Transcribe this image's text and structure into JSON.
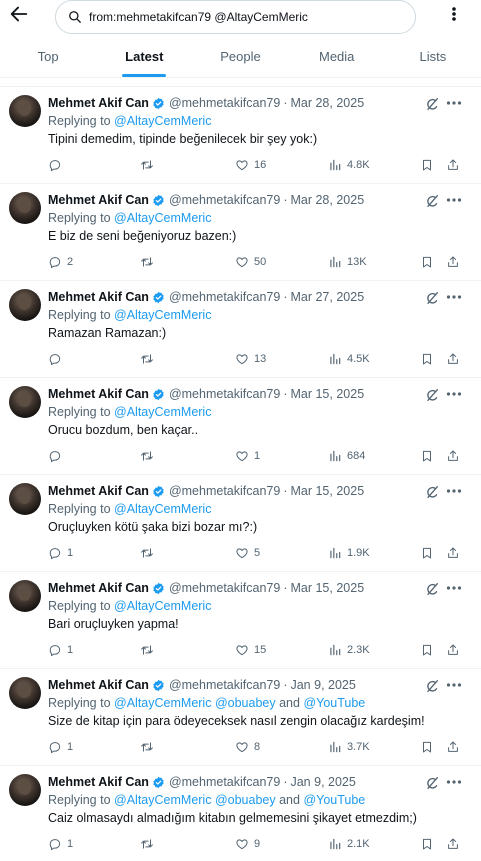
{
  "search": {
    "query": "from:mehmetakifcan79 @AltayCemMeric"
  },
  "tabs": [
    {
      "label": "Top",
      "active": false
    },
    {
      "label": "Latest",
      "active": true
    },
    {
      "label": "People",
      "active": false
    },
    {
      "label": "Media",
      "active": false
    },
    {
      "label": "Lists",
      "active": false
    }
  ],
  "colors": {
    "accent": "#1d9bf0",
    "muted": "#536471",
    "text": "#0f1419"
  },
  "tweets": [
    {
      "name": "Mehmet Akif Can",
      "handle": "@mehmetakifcan79",
      "date": "Mar 28, 2025",
      "replying_prefix": "Replying to",
      "mentions": [
        "@AltayCemMeric"
      ],
      "text": "Tipini demedim, tipinde beğenilecek bir şey yok:)",
      "replies": "",
      "retweets": "",
      "likes": "16",
      "views": "4.8K"
    },
    {
      "name": "Mehmet Akif Can",
      "handle": "@mehmetakifcan79",
      "date": "Mar 28, 2025",
      "replying_prefix": "Replying to",
      "mentions": [
        "@AltayCemMeric"
      ],
      "text": "E biz de seni beğeniyoruz bazen:)",
      "replies": "2",
      "retweets": "",
      "likes": "50",
      "views": "13K"
    },
    {
      "name": "Mehmet Akif Can",
      "handle": "@mehmetakifcan79",
      "date": "Mar 27, 2025",
      "replying_prefix": "Replying to",
      "mentions": [
        "@AltayCemMeric"
      ],
      "text": "Ramazan Ramazan:)",
      "replies": "",
      "retweets": "",
      "likes": "13",
      "views": "4.5K"
    },
    {
      "name": "Mehmet Akif Can",
      "handle": "@mehmetakifcan79",
      "date": "Mar 15, 2025",
      "replying_prefix": "Replying to",
      "mentions": [
        "@AltayCemMeric"
      ],
      "text": "Orucu bozdum, ben kaçar..",
      "replies": "",
      "retweets": "",
      "likes": "1",
      "views": "684"
    },
    {
      "name": "Mehmet Akif Can",
      "handle": "@mehmetakifcan79",
      "date": "Mar 15, 2025",
      "replying_prefix": "Replying to",
      "mentions": [
        "@AltayCemMeric"
      ],
      "text": "Oruçluyken kötü şaka bizi bozar mı?:)",
      "replies": "1",
      "retweets": "",
      "likes": "5",
      "views": "1.9K"
    },
    {
      "name": "Mehmet Akif Can",
      "handle": "@mehmetakifcan79",
      "date": "Mar 15, 2025",
      "replying_prefix": "Replying to",
      "mentions": [
        "@AltayCemMeric"
      ],
      "text": "Bari oruçluyken yapma!",
      "replies": "1",
      "retweets": "",
      "likes": "15",
      "views": "2.3K"
    },
    {
      "name": "Mehmet Akif Can",
      "handle": "@mehmetakifcan79",
      "date": "Jan 9, 2025",
      "replying_prefix": "Replying to",
      "mentions": [
        "@AltayCemMeric",
        "@obuabey",
        "and",
        "@YouTube"
      ],
      "text": "Size de kitap için para ödeyeceksek nasıl zengin olacağız kardeşim!",
      "replies": "1",
      "retweets": "",
      "likes": "8",
      "views": "3.7K"
    },
    {
      "name": "Mehmet Akif Can",
      "handle": "@mehmetakifcan79",
      "date": "Jan 9, 2025",
      "replying_prefix": "Replying to",
      "mentions": [
        "@AltayCemMeric",
        "@obuabey",
        "and",
        "@YouTube"
      ],
      "text": "Caiz olmasaydı almadığım kitabın gelmemesini şikayet etmezdim;)",
      "replies": "1",
      "retweets": "",
      "likes": "9",
      "views": "2.1K"
    }
  ]
}
